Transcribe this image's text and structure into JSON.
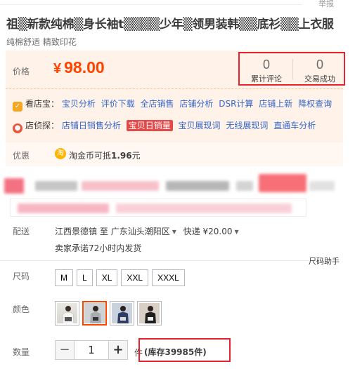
{
  "report_label": "举报",
  "title": "祖▒新款纯棉▒身长袖t▒▒▒▒少年▒领男装韩▒▒底衫▒▒上衣服",
  "subtitle": "纯棉舒适 精致印花",
  "price": {
    "label": "价格",
    "currency": "¥",
    "value": "98.00"
  },
  "stats": {
    "reviews": {
      "count": "0",
      "label": "累计评论"
    },
    "sales": {
      "count": "0",
      "label": "交易成功"
    },
    "highlight_color": "#e8212e"
  },
  "plugins": {
    "kandiangbao": {
      "head": "看店宝：",
      "links": [
        "宝贝分析",
        "评价下载",
        "全店销售",
        "店铺分析",
        "DSR计算",
        "店铺上新",
        "降权查询"
      ]
    },
    "diantan": {
      "head": "店侦探：",
      "links": [
        "店铺日销售分析",
        "宝贝日销量",
        "宝贝展现词",
        "无线展现词",
        "直通车分析"
      ],
      "highlighted_index": 1
    }
  },
  "promo": {
    "label": "优惠",
    "coin_icon": "淘",
    "text_prefix": "淘金币可抵",
    "amount": "1.96",
    "suffix": "元"
  },
  "shipping": {
    "label": "配送",
    "from": "江西景德镇",
    "to_word": "至",
    "destination": "广东汕头潮阳区",
    "method": "快递",
    "fee": "¥20.00",
    "promise": "卖家承诺72小时内发货"
  },
  "size_helper": "尺码助手",
  "sizes": {
    "label": "尺码",
    "options": [
      "M",
      "L",
      "XL",
      "XXL",
      "XXXL"
    ]
  },
  "colors": {
    "label": "颜色",
    "selected_index": 1,
    "count": 4
  },
  "quantity": {
    "label": "数量",
    "value": "1",
    "minus": "−",
    "plus": "+",
    "unit": "件",
    "stock": "(库存39985件)"
  },
  "colors_palette": {
    "price": "#ff4400",
    "link": "#3366cc",
    "panel_bg": "#fff2e8"
  }
}
